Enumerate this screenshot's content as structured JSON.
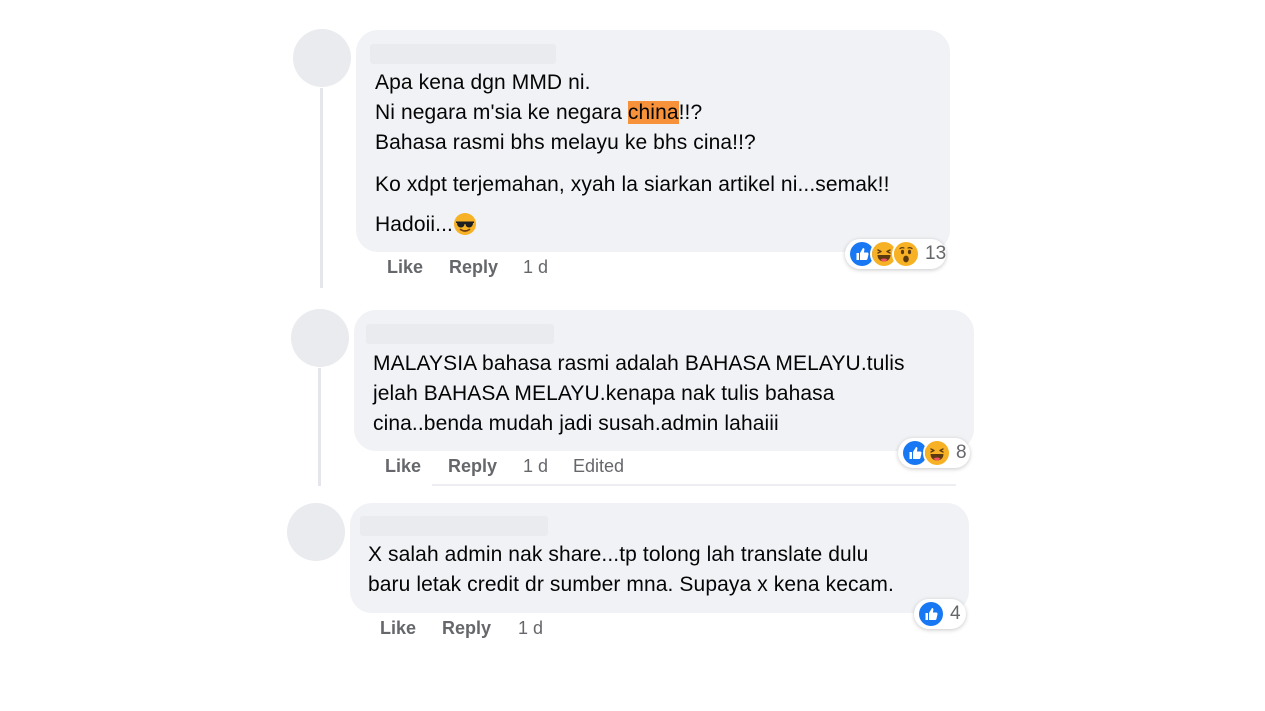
{
  "colors": {
    "bubble_bg": "#f0f2f5",
    "avatar_bg": "#e9ebee",
    "secondary_text": "#65676b",
    "highlight": "#f7923a",
    "like_blue": "#1877f2",
    "haha_yellow": "#f7b125"
  },
  "comments": [
    {
      "lines": [
        "Apa kena dgn MMD ni.",
        "Ni negara m'sia ke negara ",
        "china",
        "!!?",
        "Bahasa rasmi bhs melayu ke bhs cina!!?",
        "Ko xdpt terjemahan, xyah la siarkan artikel ni...semak!!",
        "Hadoii..."
      ],
      "emoji": "sunglasses-emoji",
      "reactions": [
        "like",
        "haha",
        "wow"
      ],
      "reaction_count": "13",
      "actions": {
        "like": "Like",
        "reply": "Reply",
        "time": "1 d"
      }
    },
    {
      "lines": [
        "MALAYSIA bahasa rasmi adalah BAHASA MELAYU.tulis",
        "jelah BAHASA MELAYU.kenapa nak tulis bahasa",
        "cina..benda mudah jadi susah.admin lahaiii"
      ],
      "reactions": [
        "like",
        "haha"
      ],
      "reaction_count": "8",
      "actions": {
        "like": "Like",
        "reply": "Reply",
        "time": "1 d",
        "edited": "Edited"
      }
    },
    {
      "lines": [
        "X salah admin nak share...tp tolong lah translate dulu",
        "baru letak credit dr sumber mna. Supaya x kena kecam."
      ],
      "reactions": [
        "like"
      ],
      "reaction_count": "4",
      "actions": {
        "like": "Like",
        "reply": "Reply",
        "time": "1 d"
      }
    }
  ]
}
